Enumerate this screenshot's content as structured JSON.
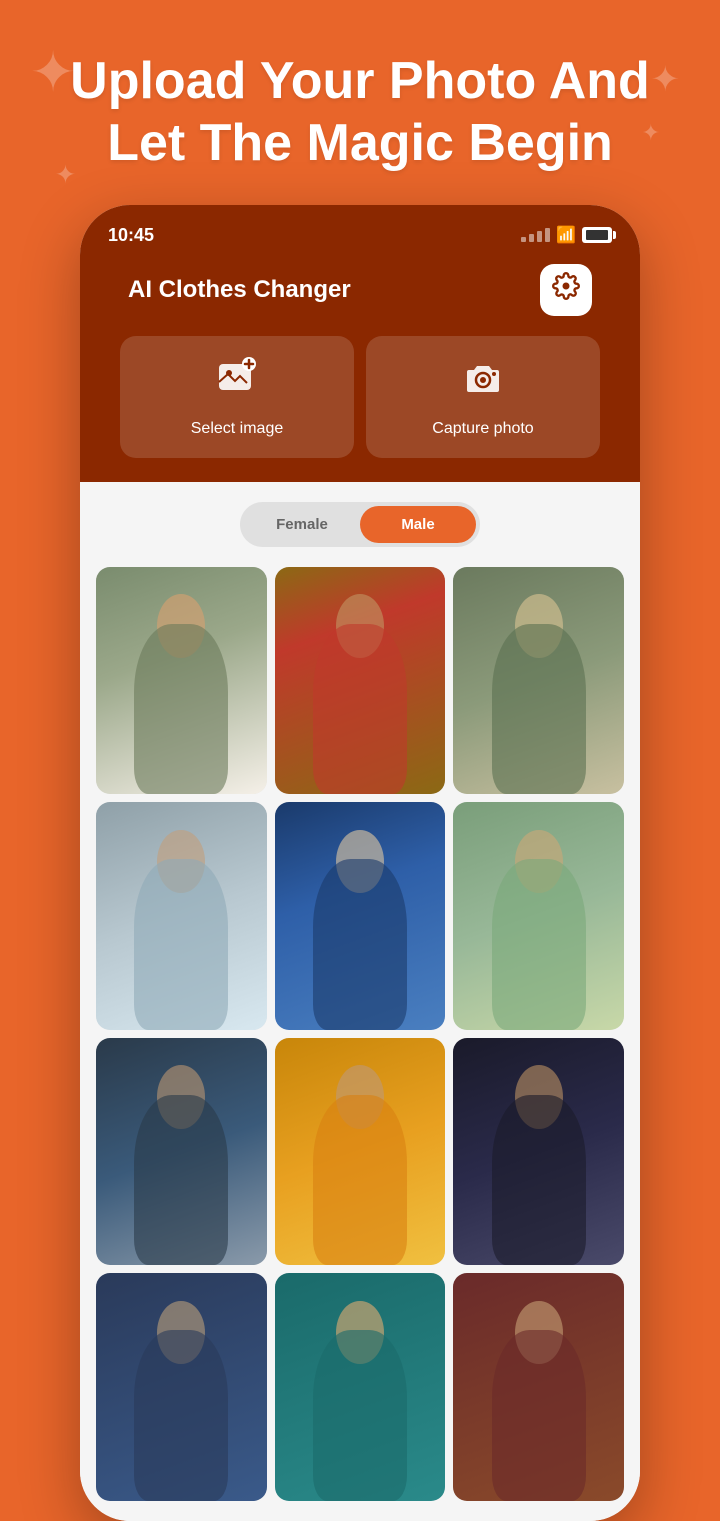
{
  "background_color": "#E8652A",
  "header": {
    "title": "Upload Your Photo And Let The Magic Begin"
  },
  "status_bar": {
    "time": "10:45",
    "signal": "signal",
    "wifi": "wifi",
    "battery": "battery"
  },
  "app": {
    "title": "AI Clothes Changer",
    "settings_icon": "⚙",
    "actions": [
      {
        "id": "select-image",
        "icon": "🖼",
        "label": "Select image"
      },
      {
        "id": "capture-photo",
        "icon": "📷",
        "label": "Capture photo"
      }
    ]
  },
  "gender_toggle": {
    "options": [
      "Female",
      "Male"
    ],
    "active": "Male"
  },
  "models": [
    {
      "id": 1,
      "style": "p1",
      "gender": "male",
      "description": "Man in olive jacket"
    },
    {
      "id": 2,
      "style": "p2",
      "gender": "male",
      "description": "Man in red t-shirt"
    },
    {
      "id": 3,
      "style": "p3",
      "gender": "male",
      "description": "Man in green shirt"
    },
    {
      "id": 4,
      "style": "p4",
      "gender": "male",
      "description": "Man in light blue kurta"
    },
    {
      "id": 5,
      "style": "p5",
      "gender": "male",
      "description": "Man in blue suit"
    },
    {
      "id": 6,
      "style": "p6",
      "gender": "male",
      "description": "Man in mint kurta"
    },
    {
      "id": 7,
      "style": "p7",
      "gender": "male",
      "description": "Man in dark coat"
    },
    {
      "id": 8,
      "style": "p8",
      "gender": "male",
      "description": "Man in orange jacket"
    },
    {
      "id": 9,
      "style": "p9",
      "gender": "male",
      "description": "Man in dark suit"
    },
    {
      "id": 10,
      "style": "p10",
      "gender": "male",
      "description": "Man standing"
    },
    {
      "id": 11,
      "style": "p11",
      "gender": "male",
      "description": "Man teal background"
    },
    {
      "id": 12,
      "style": "p12",
      "gender": "male",
      "description": "Man dark background"
    }
  ]
}
